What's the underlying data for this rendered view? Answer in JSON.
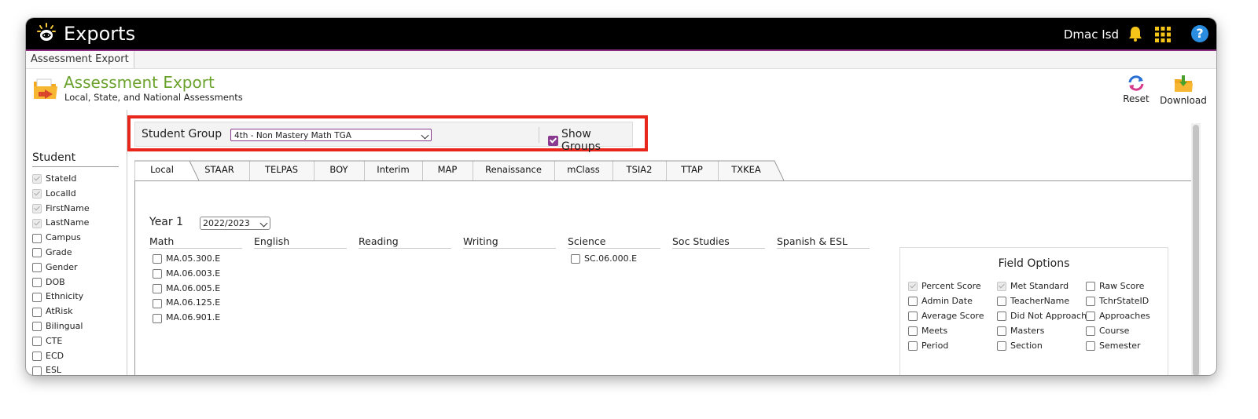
{
  "header": {
    "app_title": "Exports",
    "user_name": "Dmac Isd"
  },
  "breadcrumb": {
    "tab_label": "Assessment Export"
  },
  "page": {
    "title": "Assessment Export",
    "subtitle": "Local, State, and National Assessments"
  },
  "toolbar": {
    "reset_label": "Reset",
    "download_label": "Download"
  },
  "student_group": {
    "label": "Student Group",
    "selected": "4th - Non Mastery Math TGA",
    "show_groups_label": "Show Groups",
    "show_groups_checked": true
  },
  "student": {
    "heading": "Student",
    "fields": [
      {
        "label": "StateId",
        "checked": true,
        "disabled": true
      },
      {
        "label": "LocalId",
        "checked": true,
        "disabled": true
      },
      {
        "label": "FirstName",
        "checked": true,
        "disabled": true
      },
      {
        "label": "LastName",
        "checked": true,
        "disabled": true
      },
      {
        "label": "Campus",
        "checked": false
      },
      {
        "label": "Grade",
        "checked": false
      },
      {
        "label": "Gender",
        "checked": false
      },
      {
        "label": "DOB",
        "checked": false
      },
      {
        "label": "Ethnicity",
        "checked": false
      },
      {
        "label": "AtRisk",
        "checked": false
      },
      {
        "label": "Bilingual",
        "checked": false
      },
      {
        "label": "CTE",
        "checked": false
      },
      {
        "label": "ECD",
        "checked": false
      },
      {
        "label": "ESL",
        "checked": false
      }
    ]
  },
  "tabs": [
    "Local",
    "STAAR",
    "TELPAS",
    "BOY",
    "Interim",
    "MAP",
    "Renaissance",
    "mClass",
    "TSIA2",
    "TTAP",
    "TXKEA"
  ],
  "active_tab": "Local",
  "year": {
    "label": "Year 1",
    "selected": "2022/2023"
  },
  "subjects": [
    "Math",
    "English",
    "Reading",
    "Writing",
    "Science",
    "Soc Studies",
    "Spanish & ESL"
  ],
  "assessments": {
    "math": [
      "MA.05.300.E",
      "MA.06.003.E",
      "MA.06.005.E",
      "MA.06.125.E",
      "MA.06.901.E"
    ],
    "science": [
      "SC.06.000.E"
    ]
  },
  "field_options": {
    "title": "Field Options",
    "options": [
      {
        "label": "Percent Score",
        "checked": true,
        "disabled": true
      },
      {
        "label": "Met Standard",
        "checked": true,
        "disabled": true
      },
      {
        "label": "Raw Score",
        "checked": false
      },
      {
        "label": "Admin Date",
        "checked": false
      },
      {
        "label": "TeacherName",
        "checked": false
      },
      {
        "label": "TchrStateID",
        "checked": false
      },
      {
        "label": "Average Score",
        "checked": false
      },
      {
        "label": "Did Not Approach",
        "checked": false
      },
      {
        "label": "Approaches",
        "checked": false
      },
      {
        "label": "Meets",
        "checked": false
      },
      {
        "label": "Masters",
        "checked": false
      },
      {
        "label": "Course",
        "checked": false
      },
      {
        "label": "Period",
        "checked": false
      },
      {
        "label": "Section",
        "checked": false
      },
      {
        "label": "Semester",
        "checked": false
      }
    ]
  },
  "colors": {
    "accent": "#8a3a8f",
    "title_green": "#6aa22c",
    "highlight_red": "#e8261c"
  }
}
